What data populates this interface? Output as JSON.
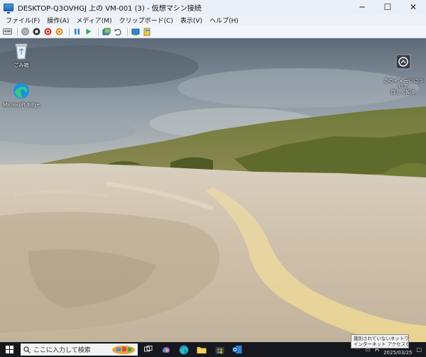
{
  "window": {
    "title": "DESKTOP-Q3OVHGJ 上の VM-001 (3) - 仮想マシン接続",
    "controls": {
      "minimize": "─",
      "maximize": "☐",
      "close": "✕"
    }
  },
  "menu": {
    "items": [
      "ファイル(F)",
      "操作(A)",
      "メディア(M)",
      "クリップボード(C)",
      "表示(V)",
      "ヘルプ(H)"
    ]
  },
  "toolbar": {
    "icons": [
      "ctrl-alt-del",
      "start",
      "turn-off",
      "shutdown",
      "save",
      "pause",
      "resume",
      "checkpoint",
      "revert",
      "enhanced-session",
      "share"
    ]
  },
  "desktop": {
    "icons": [
      {
        "id": "recycle-bin",
        "label": "ごみ箱"
      },
      {
        "id": "edge",
        "label": "Microsoft Edge"
      },
      {
        "id": "help",
        "label": "このイメージについて\n詳しく知る"
      }
    ]
  },
  "taskbar": {
    "search_placeholder": "ここに入力して検索",
    "date": "2025/03/25",
    "ime": "A"
  },
  "tooltip": {
    "line1": "識別されていないネットワーク",
    "line2": "インターネット アクセスなし"
  }
}
